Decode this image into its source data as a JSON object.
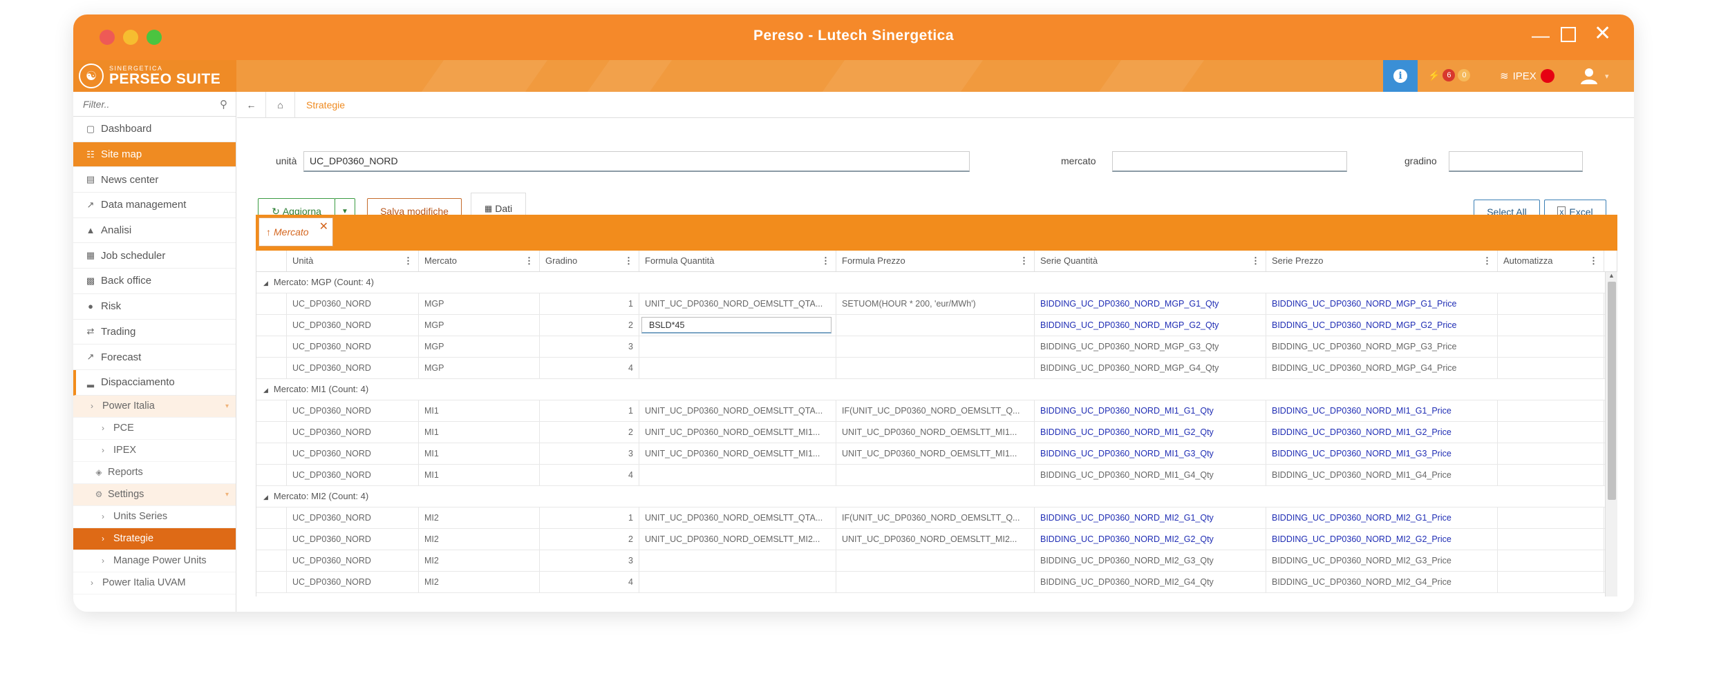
{
  "window": {
    "title": "Pereso - Lutech Sinergetica"
  },
  "app": {
    "logo_small": "SINERGETICA",
    "logo_big": "PERSEO SUITE",
    "notif_count_red": "6",
    "notif_count_orange": "0",
    "ipex_label": "IPEX"
  },
  "sidebar": {
    "filter_placeholder": "Filter..",
    "items": [
      {
        "label": "Dashboard",
        "icon": "monitor-icon"
      },
      {
        "label": "Site map",
        "icon": "sitemap-icon"
      },
      {
        "label": "News center",
        "icon": "newspaper-icon"
      },
      {
        "label": "Data management",
        "icon": "chart-line-icon"
      },
      {
        "label": "Analisi",
        "icon": "flask-icon"
      },
      {
        "label": "Job scheduler",
        "icon": "calendar-icon"
      },
      {
        "label": "Back office",
        "icon": "money-icon"
      },
      {
        "label": "Risk",
        "icon": "bomb-icon"
      },
      {
        "label": "Trading",
        "icon": "exchange-icon"
      },
      {
        "label": "Forecast",
        "icon": "chart-line-icon"
      },
      {
        "label": "Dispacciamento",
        "icon": "bar-chart-icon"
      }
    ],
    "sub": {
      "power_italia": "Power Italia",
      "pce": "PCE",
      "ipex": "IPEX",
      "reports": "Reports",
      "settings": "Settings",
      "units_series": "Units Series",
      "strategie": "Strategie",
      "manage_power_units": "Manage Power Units",
      "power_italia_uvam": "Power Italia UVAM"
    }
  },
  "breadcrumb": {
    "current": "Strategie"
  },
  "filters": {
    "unita_label": "unità",
    "unita_value": "UC_DP0360_NORD",
    "mercato_label": "mercato",
    "mercato_value": "",
    "gradino_label": "gradino",
    "gradino_value": ""
  },
  "toolbar": {
    "aggiorna": "Aggiorna",
    "salva": "Salva modifiche",
    "dati": "Dati",
    "select_all": "Select All",
    "excel": "Excel"
  },
  "grouping": {
    "chip_label": "Mercato"
  },
  "columns": [
    "Unità",
    "Mercato",
    "Gradino",
    "Formula Quantità",
    "Formula Prezzo",
    "Serie Quantità",
    "Serie Prezzo",
    "Automatizza"
  ],
  "groups": [
    {
      "title": "Mercato: MGP (Count: 4)",
      "rows": [
        [
          "UC_DP0360_NORD",
          "MGP",
          "1",
          "UNIT_UC_DP0360_NORD_OEMSLTT_QTA...",
          "SETUOM(HOUR * 200, 'eur/MWh')",
          "BIDDING_UC_DP0360_NORD_MGP_G1_Qty",
          "BIDDING_UC_DP0360_NORD_MGP_G1_Price",
          ""
        ],
        [
          "UC_DP0360_NORD",
          "MGP",
          "2",
          "BSLD*45",
          "",
          "BIDDING_UC_DP0360_NORD_MGP_G2_Qty",
          "BIDDING_UC_DP0360_NORD_MGP_G2_Price",
          ""
        ],
        [
          "UC_DP0360_NORD",
          "MGP",
          "3",
          "",
          "",
          "BIDDING_UC_DP0360_NORD_MGP_G3_Qty",
          "BIDDING_UC_DP0360_NORD_MGP_G3_Price",
          ""
        ],
        [
          "UC_DP0360_NORD",
          "MGP",
          "4",
          "",
          "",
          "BIDDING_UC_DP0360_NORD_MGP_G4_Qty",
          "BIDDING_UC_DP0360_NORD_MGP_G4_Price",
          ""
        ]
      ]
    },
    {
      "title": "Mercato: MI1 (Count: 4)",
      "rows": [
        [
          "UC_DP0360_NORD",
          "MI1",
          "1",
          "UNIT_UC_DP0360_NORD_OEMSLTT_QTA...",
          "IF(UNIT_UC_DP0360_NORD_OEMSLTT_Q...",
          "BIDDING_UC_DP0360_NORD_MI1_G1_Qty",
          "BIDDING_UC_DP0360_NORD_MI1_G1_Price",
          ""
        ],
        [
          "UC_DP0360_NORD",
          "MI1",
          "2",
          "UNIT_UC_DP0360_NORD_OEMSLTT_MI1...",
          "UNIT_UC_DP0360_NORD_OEMSLTT_MI1...",
          "BIDDING_UC_DP0360_NORD_MI1_G2_Qty",
          "BIDDING_UC_DP0360_NORD_MI1_G2_Price",
          ""
        ],
        [
          "UC_DP0360_NORD",
          "MI1",
          "3",
          "UNIT_UC_DP0360_NORD_OEMSLTT_MI1...",
          "UNIT_UC_DP0360_NORD_OEMSLTT_MI1...",
          "BIDDING_UC_DP0360_NORD_MI1_G3_Qty",
          "BIDDING_UC_DP0360_NORD_MI1_G3_Price",
          ""
        ],
        [
          "UC_DP0360_NORD",
          "MI1",
          "4",
          "",
          "",
          "BIDDING_UC_DP0360_NORD_MI1_G4_Qty",
          "BIDDING_UC_DP0360_NORD_MI1_G4_Price",
          ""
        ]
      ]
    },
    {
      "title": "Mercato: MI2 (Count: 4)",
      "rows": [
        [
          "UC_DP0360_NORD",
          "MI2",
          "1",
          "UNIT_UC_DP0360_NORD_OEMSLTT_QTA...",
          "IF(UNIT_UC_DP0360_NORD_OEMSLTT_Q...",
          "BIDDING_UC_DP0360_NORD_MI2_G1_Qty",
          "BIDDING_UC_DP0360_NORD_MI2_G1_Price",
          ""
        ],
        [
          "UC_DP0360_NORD",
          "MI2",
          "2",
          "UNIT_UC_DP0360_NORD_OEMSLTT_MI2...",
          "UNIT_UC_DP0360_NORD_OEMSLTT_MI2...",
          "BIDDING_UC_DP0360_NORD_MI2_G2_Qty",
          "BIDDING_UC_DP0360_NORD_MI2_G2_Price",
          ""
        ],
        [
          "UC_DP0360_NORD",
          "MI2",
          "3",
          "",
          "",
          "BIDDING_UC_DP0360_NORD_MI2_G3_Qty",
          "BIDDING_UC_DP0360_NORD_MI2_G3_Price",
          ""
        ],
        [
          "UC_DP0360_NORD",
          "MI2",
          "4",
          "",
          "",
          "BIDDING_UC_DP0360_NORD_MI2_G4_Qty",
          "BIDDING_UC_DP0360_NORD_MI2_G4_Price",
          ""
        ]
      ]
    }
  ],
  "colors": {
    "accent": "#f28c1c",
    "link": "#1f2db4",
    "selected_nav": "#de6a16"
  }
}
